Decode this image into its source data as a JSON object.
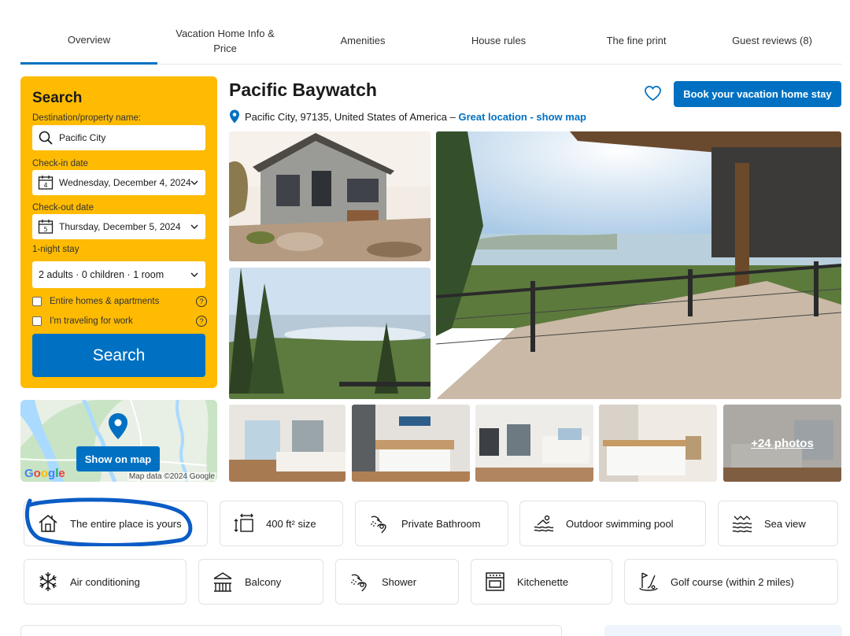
{
  "tabs": [
    {
      "label": "Overview"
    },
    {
      "label": "Vacation Home Info & Price"
    },
    {
      "label": "Amenities"
    },
    {
      "label": "House rules"
    },
    {
      "label": "The fine print"
    },
    {
      "label": "Guest reviews (8)"
    }
  ],
  "search": {
    "title": "Search",
    "destination_label": "Destination/property name:",
    "destination_value": "Pacific City",
    "checkin_label": "Check-in date",
    "checkin_value": "Wednesday, December 4, 2024",
    "checkin_day": "4",
    "checkout_label": "Check-out date",
    "checkout_value": "Thursday, December 5, 2024",
    "checkout_day": "5",
    "stay_length": "1-night stay",
    "guests_value": "2 adults · 0 children · 1 room",
    "check_entire_homes": "Entire homes & apartments",
    "check_work": "I'm traveling for work",
    "help_glyph": "?",
    "button_label": "Search"
  },
  "map": {
    "button_label": "Show on map",
    "google_logo": "Google",
    "credit": "Map data ©2024 Google"
  },
  "property": {
    "name": "Pacific Baywatch",
    "address": "Pacific City, 97135, United States of America –",
    "location_link": "Great location - show map",
    "book_button": "Book your vacation home stay"
  },
  "gallery": {
    "more_label": "+24 photos"
  },
  "facilities": [
    {
      "label": "The entire place is yours",
      "icon": "house-icon"
    },
    {
      "label": "400 ft² size",
      "icon": "size-arrows-icon"
    },
    {
      "label": "Private Bathroom",
      "icon": "shower-icon"
    },
    {
      "label": "Outdoor swimming pool",
      "icon": "pool-icon"
    },
    {
      "label": "Sea view",
      "icon": "waves-icon"
    },
    {
      "label": "Air conditioning",
      "icon": "snowflake-icon"
    },
    {
      "label": "Balcony",
      "icon": "balcony-icon"
    },
    {
      "label": "Shower",
      "icon": "shower-icon"
    },
    {
      "label": "Kitchenette",
      "icon": "oven-icon"
    },
    {
      "label": "Golf course (within 2 miles)",
      "icon": "golf-icon"
    }
  ],
  "colors": {
    "accent": "#0071c2",
    "search_panel": "#febb02",
    "annotation": "#0b5cc5"
  }
}
